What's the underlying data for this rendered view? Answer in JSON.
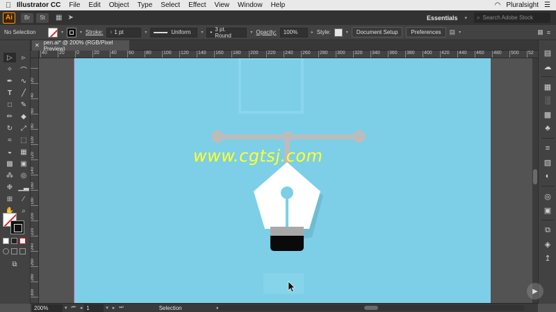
{
  "menubar": {
    "app_name": "Illustrator CC",
    "items": [
      "File",
      "Edit",
      "Object",
      "Type",
      "Select",
      "Effect",
      "View",
      "Window",
      "Help"
    ],
    "right_label": "Pluralsight"
  },
  "appbar": {
    "logo": "Ai",
    "bridge": "Br",
    "stock": "St",
    "workspace": "Essentials",
    "search_placeholder": "Search Adobe Stock"
  },
  "controlbar": {
    "selection_label": "No Selection",
    "stroke_label": "Stroke:",
    "stroke_weight": "1 pt",
    "stroke_profile": "Uniform",
    "brush": "3 pt. Round",
    "opacity_label": "Opacity:",
    "opacity_value": "100%",
    "style_label": "Style:",
    "document_setup": "Document Setup",
    "preferences": "Preferences"
  },
  "document": {
    "tab_title": "pen.ai* @ 200% (RGB/Pixel Preview)"
  },
  "rulers": {
    "horizontal": [
      "40",
      "20",
      "0",
      "20",
      "40",
      "60",
      "80",
      "100",
      "120",
      "140",
      "160",
      "180",
      "200",
      "220",
      "240",
      "260",
      "280",
      "300",
      "320",
      "340",
      "360",
      "380",
      "400",
      "420",
      "440",
      "460",
      "480",
      "500",
      "52"
    ],
    "vertical": [
      "20",
      "40",
      "60",
      "80",
      "100",
      "120",
      "140",
      "160",
      "180",
      "200",
      "220",
      "240",
      "260",
      "280",
      "300",
      "320"
    ]
  },
  "watermark": "www.cgtsj.com",
  "statusbar": {
    "zoom": "200%",
    "page": "1",
    "status": "Selection"
  },
  "colors": {
    "artboard": "#7ccfe7",
    "accent_orange": "#ff9a00"
  }
}
